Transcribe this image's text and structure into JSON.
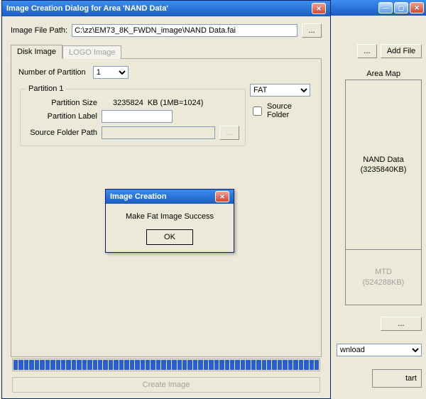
{
  "bg_window": {
    "add_file": "Add File",
    "dots": "...",
    "area_map_label": "Area Map",
    "seg1_name": "NAND Data",
    "seg1_size": "(3235840KB)",
    "seg2_name": "MTD",
    "seg2_size": "(524288KB)",
    "download_value": "wnload",
    "start_text": "tart"
  },
  "dialog": {
    "title": "Image Creation Dialog for Area 'NAND Data'",
    "file_path_label": "Image File Path:",
    "file_path_value": "C:\\zz\\EM73_8K_FWDN_image\\NAND Data.fai",
    "browse": "...",
    "tabs": {
      "disk": "Disk Image",
      "logo": "LOGO Image"
    },
    "num_partition_label": "Number of Partition",
    "num_partition_value": "1",
    "partition1_legend": "Partition 1",
    "partition_size_label": "Partition Size",
    "partition_size_value": "3235824",
    "partition_size_unit": "KB (1MB=1024)",
    "partition_label_label": "Partition Label",
    "partition_label_value": "",
    "source_folder_path_label": "Source Folder Path",
    "source_folder_path_value": "",
    "source_folder_browse": "...",
    "fs_type": "FAT",
    "source_folder_checkbox": "Source Folder",
    "create_image_btn": "Create Image"
  },
  "msg": {
    "title": "Image Creation",
    "body": "Make Fat Image Success",
    "ok": "OK"
  }
}
